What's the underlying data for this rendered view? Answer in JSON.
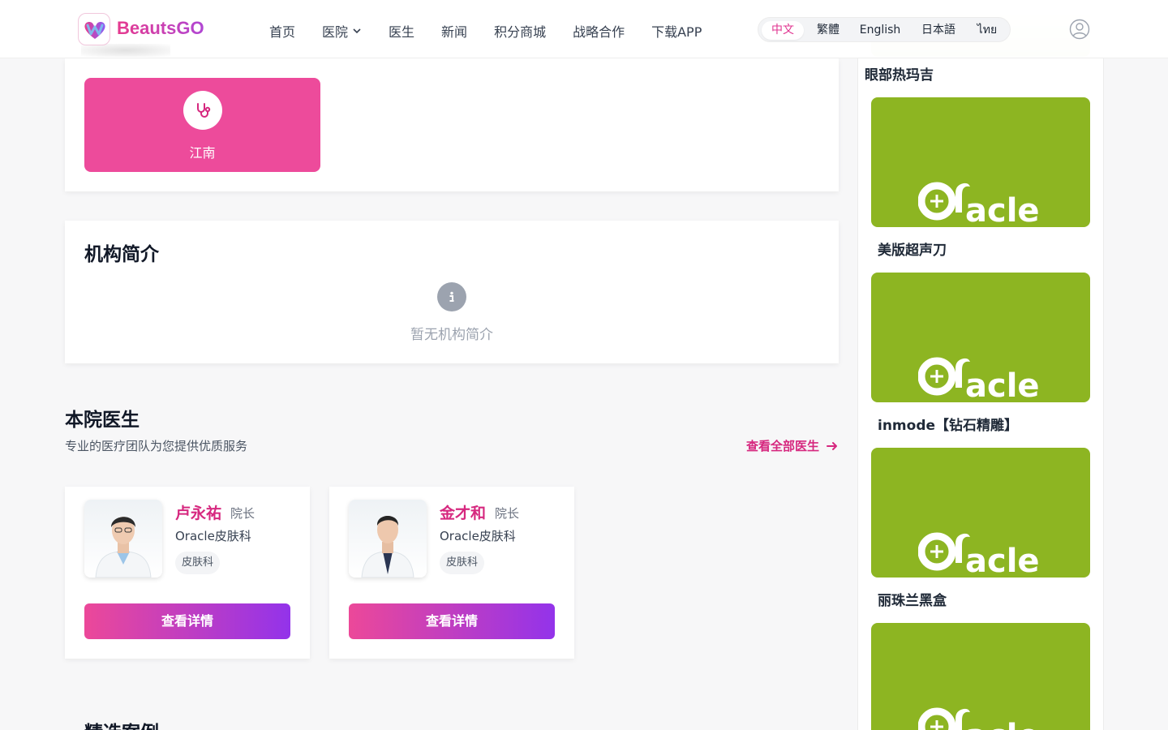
{
  "brand": {
    "name": "BeautsGO",
    "primary": "#e0338f",
    "accent": "#9333ea",
    "tile_color": "#ed4b9b",
    "sidebar_image_color": "#8db522"
  },
  "nav": {
    "items": [
      "首页",
      "医院",
      "医生",
      "新闻",
      "积分商城",
      "战略合作",
      "下载APP"
    ],
    "dropdown_item_index": 1
  },
  "languages": {
    "options": [
      "中文",
      "繁體",
      "English",
      "日本語",
      "ไทย"
    ],
    "active": "中文"
  },
  "icons": {
    "user": "user-avatar-icon",
    "stethoscope": "stethoscope-icon",
    "info": "info-icon",
    "arrow": "arrow-right-icon",
    "chevron": "chevron-down-icon"
  },
  "branch": {
    "label": "江南"
  },
  "intro": {
    "title": "机构简介",
    "empty_text": "暂无机构简介"
  },
  "doctors": {
    "title": "本院医生",
    "subtitle": "专业的医疗团队为您提供优质服务",
    "view_all": "查看全部医生",
    "list": [
      {
        "name": "卢永祐",
        "title": "院长",
        "dept": "Oracle皮肤科",
        "tag": "皮肤科",
        "button": "查看详情"
      },
      {
        "name": "金才和",
        "title": "院长",
        "dept": "Oracle皮肤科",
        "tag": "皮肤科",
        "button": "查看详情"
      }
    ]
  },
  "cases": {
    "title": "精选案例"
  },
  "sidebar": {
    "items": [
      {
        "label": "眼部热玛吉"
      },
      {
        "label": "美版超声刀",
        "logo": "Oracle"
      },
      {
        "label": "inmode【钻石精雕】",
        "logo": "Oracle"
      },
      {
        "label": "丽珠兰黑盒",
        "logo": "Oracle"
      },
      {
        "label": "",
        "logo": "Oracle"
      }
    ]
  }
}
